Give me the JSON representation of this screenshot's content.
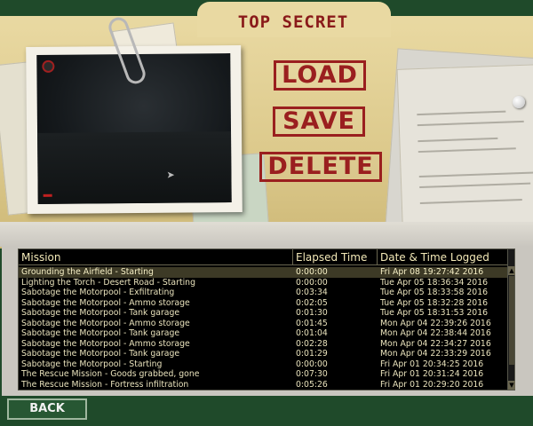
{
  "header": {
    "title": "TOP SECRET"
  },
  "actions": {
    "load_label": "LOAD",
    "save_label": "SAVE",
    "delete_label": "DELETE"
  },
  "table": {
    "columns": [
      "Mission",
      "Elapsed Time",
      "Date & Time Logged"
    ],
    "selected_index": 0,
    "rows": [
      {
        "mission": "Grounding the Airfield - Starting",
        "elapsed": "0:00:00",
        "date": "Fri Apr 08 19:27:42 2016"
      },
      {
        "mission": "Lighting the Torch - Desert Road - Starting",
        "elapsed": "0:00:00",
        "date": "Tue Apr 05 18:36:34 2016"
      },
      {
        "mission": "Sabotage the Motorpool - Exfiltrating",
        "elapsed": "0:03:34",
        "date": "Tue Apr 05 18:33:58 2016"
      },
      {
        "mission": "Sabotage the Motorpool - Ammo storage",
        "elapsed": "0:02:05",
        "date": "Tue Apr 05 18:32:28 2016"
      },
      {
        "mission": "Sabotage the Motorpool - Tank garage",
        "elapsed": "0:01:30",
        "date": "Tue Apr 05 18:31:53 2016"
      },
      {
        "mission": "Sabotage the Motorpool - Ammo storage",
        "elapsed": "0:01:45",
        "date": "Mon Apr 04 22:39:26 2016"
      },
      {
        "mission": "Sabotage the Motorpool - Tank garage",
        "elapsed": "0:01:04",
        "date": "Mon Apr 04 22:38:44 2016"
      },
      {
        "mission": "Sabotage the Motorpool - Ammo storage",
        "elapsed": "0:02:28",
        "date": "Mon Apr 04 22:34:27 2016"
      },
      {
        "mission": "Sabotage the Motorpool - Tank garage",
        "elapsed": "0:01:29",
        "date": "Mon Apr 04 22:33:29 2016"
      },
      {
        "mission": "Sabotage the Motorpool - Starting",
        "elapsed": "0:00:00",
        "date": "Fri Apr 01 20:34:25 2016"
      },
      {
        "mission": "The Rescue Mission - Goods grabbed, gone",
        "elapsed": "0:07:30",
        "date": "Fri Apr 01 20:31:24 2016"
      },
      {
        "mission": "The Rescue Mission - Fortress infiltration",
        "elapsed": "0:05:26",
        "date": "Fri Apr 01 20:29:20 2016"
      }
    ]
  },
  "footer": {
    "back_label": "BACK"
  },
  "colors": {
    "stamp_red": "#9a1f1f",
    "list_text": "#e9e2bc",
    "header_text": "#f3e9b8",
    "back_green": "#275733"
  },
  "icons": {
    "compass": "compass-icon",
    "paperclip": "paperclip-icon",
    "pin": "pushpin-icon",
    "cursor": "cursor-icon"
  }
}
